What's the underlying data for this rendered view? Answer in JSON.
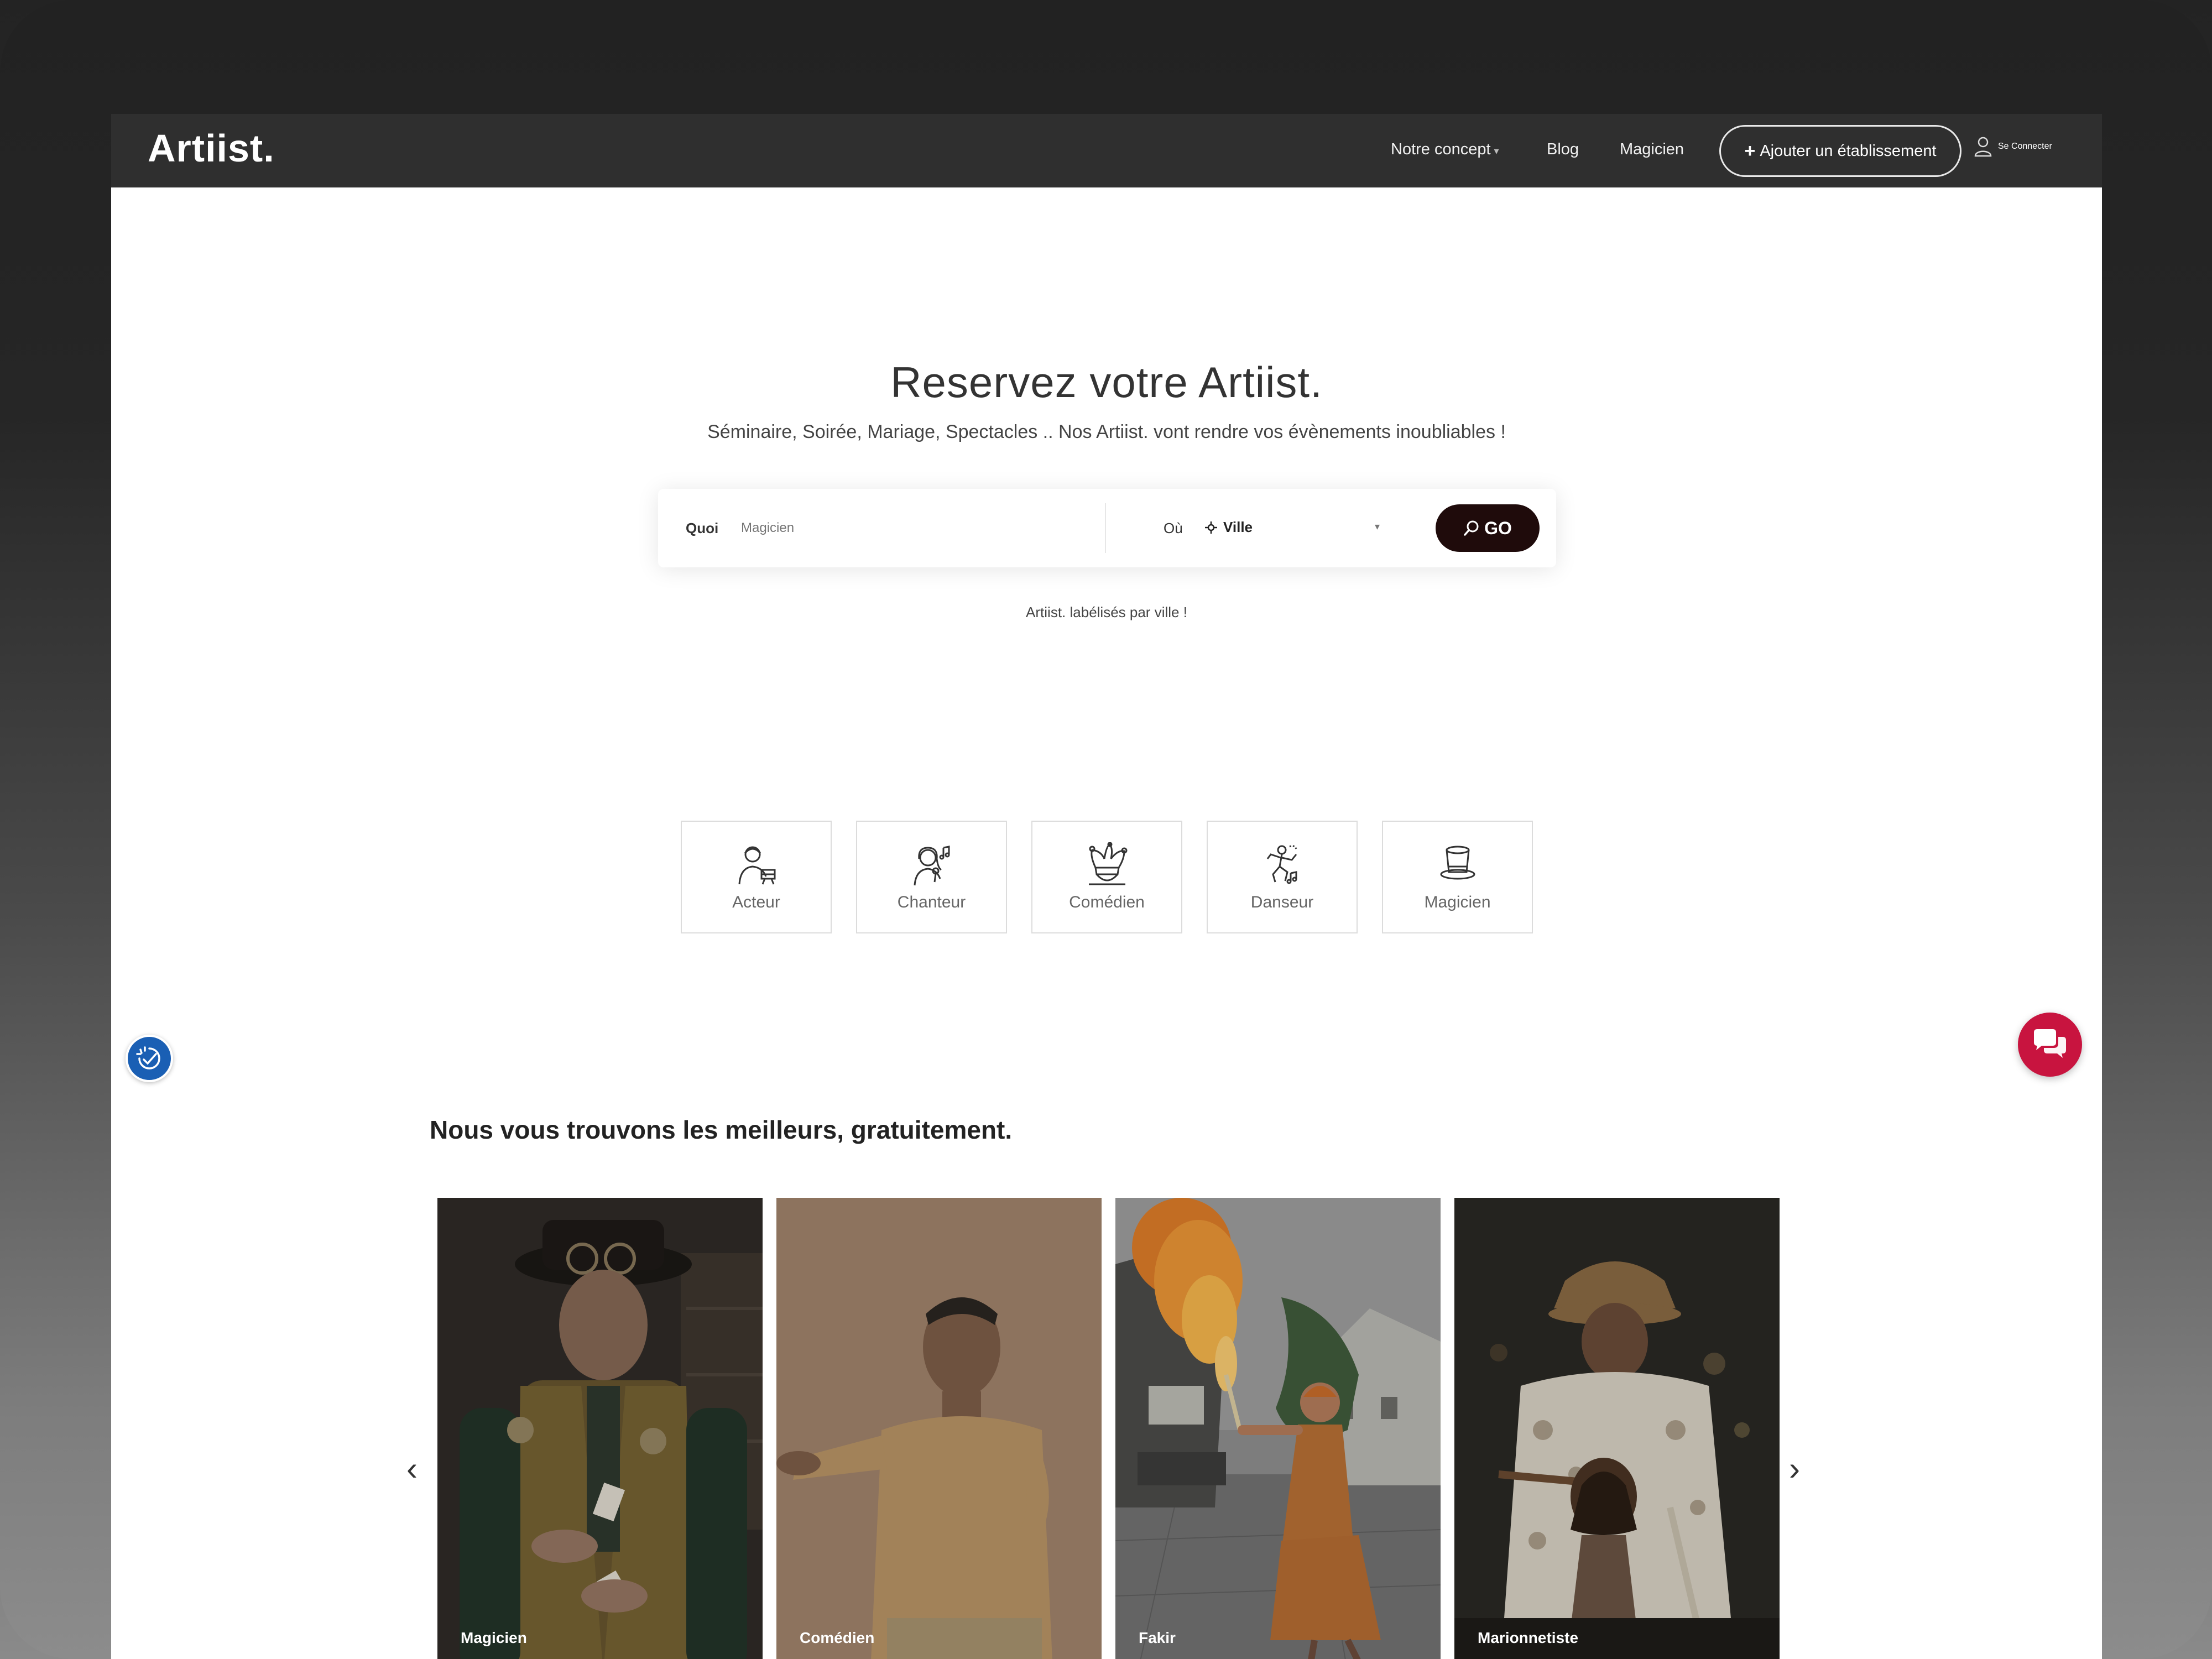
{
  "nav": {
    "logo": "Artiist.",
    "links": [
      "Notre concept",
      "Blog",
      "Magicien"
    ],
    "add_button": "Ajouter un établissement",
    "login": "Se Connecter"
  },
  "hero": {
    "title": "Reservez votre Artiist.",
    "subtitle": "Séminaire, Soirée, Mariage, Spectacles .. Nos Artiist. vont rendre vos évènements inoubliables !",
    "search": {
      "what_label": "Quoi",
      "what_placeholder": "Magicien",
      "where_label": "Où",
      "city_value": "Ville",
      "go_label": "GO"
    },
    "note": "Artiist. labélisés par ville !"
  },
  "categories": [
    {
      "label": "Acteur",
      "icon": "actor-icon"
    },
    {
      "label": "Chanteur",
      "icon": "singer-icon"
    },
    {
      "label": "Comédien",
      "icon": "jester-icon"
    },
    {
      "label": "Danseur",
      "icon": "dancer-icon"
    },
    {
      "label": "Magicien",
      "icon": "magic-hat-icon"
    }
  ],
  "section": {
    "title": "Nous vous trouvons les meilleurs, gratuitement.",
    "cards": [
      "Magicien",
      "Comédien",
      "Fakir",
      "Marionnetiste"
    ]
  },
  "colors": {
    "nav_bg": "#2f2f2f",
    "go_button": "#1f0b0b",
    "chat_button": "#c8143f",
    "accessibility_button": "#1a5fb4"
  }
}
